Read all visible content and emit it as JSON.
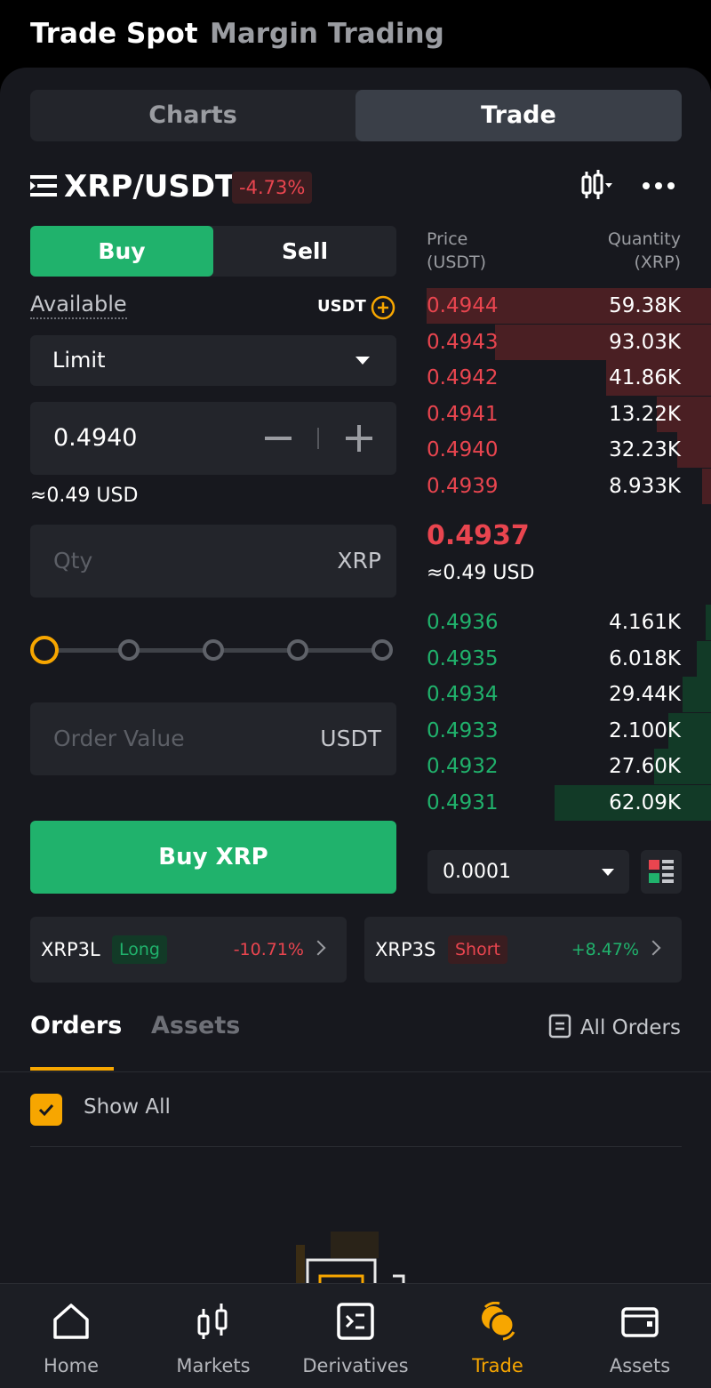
{
  "top_nav": {
    "tab_spot": "Trade Spot",
    "tab_margin": "Margin Trading"
  },
  "segment": {
    "charts": "Charts",
    "trade": "Trade"
  },
  "pair": {
    "symbol": "XRP/USDT",
    "change": "-4.73%"
  },
  "order_form": {
    "buy": "Buy",
    "sell": "Sell",
    "available_label": "Available",
    "available_currency": "USDT",
    "order_type": "Limit",
    "price": "0.4940",
    "price_usd": "≈0.49 USD",
    "qty_placeholder": "Qty",
    "qty_unit": "XRP",
    "slider_percent": 0,
    "order_value_placeholder": "Order Value",
    "order_value_unit": "USDT",
    "submit": "Buy XRP"
  },
  "order_book": {
    "price_header": "Price\n(USDT)",
    "qty_header": "Quantity\n(XRP)",
    "price_header_1": "Price",
    "price_header_2": "(USDT)",
    "qty_header_1": "Quantity",
    "qty_header_2": "(XRP)",
    "asks": [
      {
        "price": "0.4944",
        "qty": "59.38K",
        "depth": 1.0
      },
      {
        "price": "0.4943",
        "qty": "93.03K",
        "depth": 0.76
      },
      {
        "price": "0.4942",
        "qty": "41.86K",
        "depth": 0.37
      },
      {
        "price": "0.4941",
        "qty": "13.22K",
        "depth": 0.19
      },
      {
        "price": "0.4940",
        "qty": "32.23K",
        "depth": 0.12
      },
      {
        "price": "0.4939",
        "qty": "8.933K",
        "depth": 0.03
      }
    ],
    "last_price": "0.4937",
    "last_price_usd": "≈0.49 USD",
    "bids": [
      {
        "price": "0.4936",
        "qty": "4.161K",
        "depth": 0.02
      },
      {
        "price": "0.4935",
        "qty": "6.018K",
        "depth": 0.05
      },
      {
        "price": "0.4934",
        "qty": "29.44K",
        "depth": 0.1
      },
      {
        "price": "0.4933",
        "qty": "2.100K",
        "depth": 0.15
      },
      {
        "price": "0.4932",
        "qty": "27.60K",
        "depth": 0.2
      },
      {
        "price": "0.4931",
        "qty": "62.09K",
        "depth": 0.55
      }
    ],
    "precision": "0.0001"
  },
  "leveraged": [
    {
      "symbol": "XRP3L",
      "tag": "Long",
      "change": "-10.71%"
    },
    {
      "symbol": "XRP3S",
      "tag": "Short",
      "change": "+8.47%"
    }
  ],
  "orders": {
    "tab_orders": "Orders",
    "tab_assets": "Assets",
    "all_orders": "All Orders",
    "show_all": "Show All"
  },
  "bottom_nav": [
    {
      "label": "Home",
      "icon": "home-icon"
    },
    {
      "label": "Markets",
      "icon": "candlestick-icon"
    },
    {
      "label": "Derivatives",
      "icon": "derivatives-icon"
    },
    {
      "label": "Trade",
      "icon": "trade-icon"
    },
    {
      "label": "Assets",
      "icon": "wallet-icon"
    }
  ],
  "colors": {
    "buy": "#20b26c",
    "sell": "#e9454f",
    "accent": "#f7a600",
    "background": "#17181e"
  }
}
